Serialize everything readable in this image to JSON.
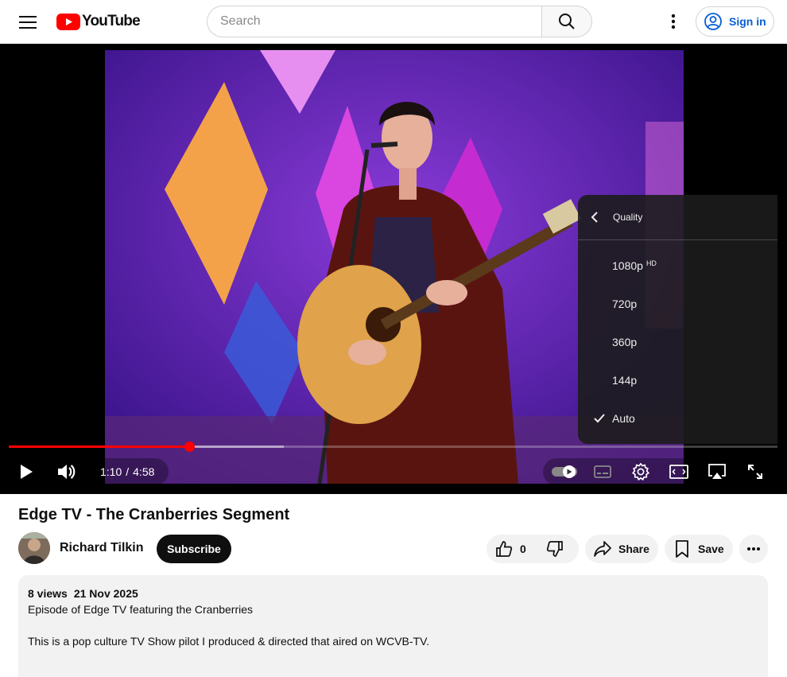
{
  "header": {
    "logo_text": "YouTube",
    "search_placeholder": "Search",
    "sign_in_label": "Sign in",
    "icons": [
      "menu-icon",
      "youtube-logo-icon",
      "search-icon",
      "more-vert-icon",
      "account-icon"
    ]
  },
  "player": {
    "current_time": "1:10",
    "duration": "4:58",
    "time_separator": "/",
    "progress_played_fraction": 0.235,
    "progress_buffered_fraction": 0.358,
    "accent_color": "#ff0000",
    "quality_menu": {
      "title": "Quality",
      "options": [
        {
          "label": "1080p",
          "badge": "HD",
          "selected": false
        },
        {
          "label": "720p",
          "badge": "",
          "selected": false
        },
        {
          "label": "360p",
          "badge": "",
          "selected": false
        },
        {
          "label": "144p",
          "badge": "",
          "selected": false
        },
        {
          "label": "Auto",
          "badge": "",
          "selected": true
        }
      ]
    }
  },
  "video": {
    "title": "Edge TV - The Cranberries Segment",
    "channel": "Richard Tilkin",
    "subscribe_label": "Subscribe",
    "like_count": "0",
    "share_label": "Share",
    "save_label": "Save"
  },
  "description": {
    "views": "8 views",
    "date": "21 Nov 2025",
    "line1": "Episode of Edge TV featuring the Cranberries",
    "line2": "This is a pop culture TV Show pilot I produced & directed that aired on WCVB-TV."
  }
}
